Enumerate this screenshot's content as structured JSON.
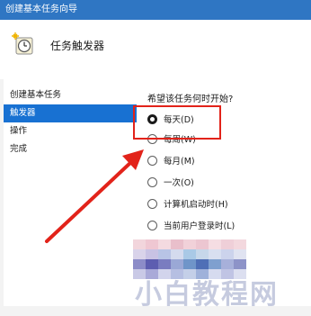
{
  "window": {
    "title": "创建基本任务向导"
  },
  "header": {
    "title": "任务触发器",
    "icon": "clock-task-icon"
  },
  "nav": {
    "items": [
      {
        "label": "创建基本任务",
        "selected": false
      },
      {
        "label": "触发器",
        "selected": true
      },
      {
        "label": "操作",
        "selected": false
      },
      {
        "label": "完成",
        "selected": false
      }
    ]
  },
  "trigger": {
    "prompt": "希望该任务何时开始?",
    "options": [
      {
        "label": "每天(D)",
        "checked": true
      },
      {
        "label": "每周(W)",
        "checked": false
      },
      {
        "label": "每月(M)",
        "checked": false
      },
      {
        "label": "一次(O)",
        "checked": false
      },
      {
        "label": "计算机启动时(H)",
        "checked": false
      },
      {
        "label": "当前用户登录时(L)",
        "checked": false
      }
    ]
  },
  "annotation": {
    "highlight_color": "#e2231a"
  },
  "watermark": {
    "text": "小白教程网"
  },
  "colors": {
    "titlebar": "#2f76c3",
    "selection": "#1871d2",
    "accent_red": "#e2231a"
  }
}
